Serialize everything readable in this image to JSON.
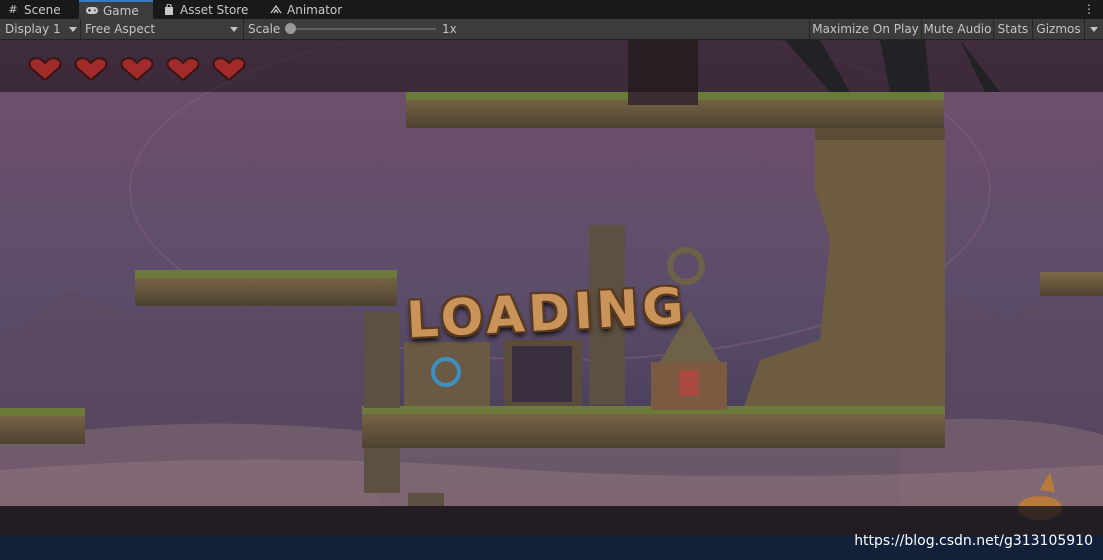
{
  "tabs": [
    {
      "label": "Scene",
      "icon": "grid-icon"
    },
    {
      "label": "Game",
      "icon": "gamepad-icon"
    },
    {
      "label": "Asset Store",
      "icon": "shopping-bag-icon"
    },
    {
      "label": "Animator",
      "icon": "animator-icon"
    }
  ],
  "active_tab": "Game",
  "toolbar": {
    "display": "Display 1",
    "aspect": "Free Aspect",
    "scale_label": "Scale",
    "scale_value": "1x",
    "maximize_on_play": "Maximize On Play",
    "mute_audio": "Mute Audio",
    "stats": "Stats",
    "gizmos": "Gizmos"
  },
  "game": {
    "hearts": 5,
    "loading_text": "LOADING",
    "watermark": "https://blog.csdn.net/g313105910"
  },
  "colors": {
    "tab_bar_bg": "#191919",
    "toolbar_bg": "#3c3c3c",
    "active_tab_accent": "#3a79bb",
    "heart": "#a12a2a",
    "loading_wood": "#c9935a"
  }
}
